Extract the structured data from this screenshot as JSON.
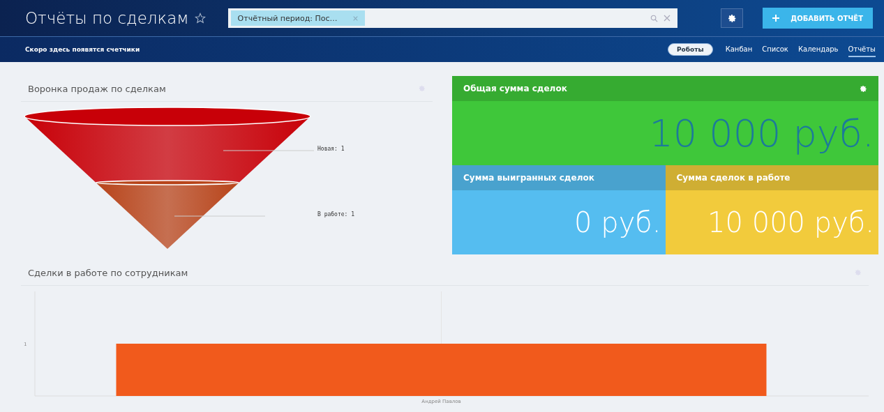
{
  "header": {
    "title": "Отчёты по сделкам",
    "filter_tag": "Отчётный период: Пос…",
    "add_button": "ДОБАВИТЬ ОТЧЁТ"
  },
  "subheader": {
    "notice": "Скоро здесь появятся счетчики",
    "robots_button": "Роботы",
    "views": [
      {
        "label": "Канбан",
        "selected": false
      },
      {
        "label": "Список",
        "selected": false
      },
      {
        "label": "Календарь",
        "selected": false
      },
      {
        "label": "Отчёты",
        "selected": true
      }
    ]
  },
  "funnel": {
    "title": "Воронка продаж по сделкам",
    "stages": [
      {
        "label": "Новая: 1",
        "color": "#c80008"
      },
      {
        "label": "В работе: 1",
        "color": "#b8441a"
      }
    ]
  },
  "totals": {
    "main": {
      "title": "Общая сумма сделок",
      "value": "10 000 руб."
    },
    "tiles": [
      {
        "title": "Сумма выигранных сделок",
        "value": "0 руб.",
        "color": "#55bdf0"
      },
      {
        "title": "Сумма сделок в работе",
        "value": "10 000 руб.",
        "color": "#f2cb3c"
      }
    ]
  },
  "employees": {
    "title": "Сделки в работе по сотрудникам",
    "y_tick": "1",
    "x_label": "Андрей Павлов"
  }
}
